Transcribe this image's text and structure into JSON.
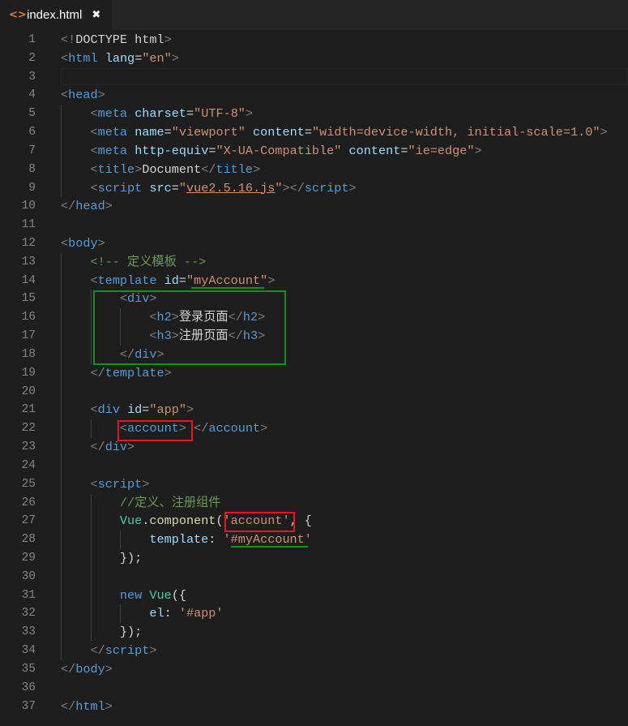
{
  "tab": {
    "icon": "html-file-icon",
    "icon_glyph": "<>",
    "label": "index.html",
    "close_glyph": "✖"
  },
  "lines": [
    {
      "n": "1"
    },
    {
      "n": "2"
    },
    {
      "n": "3"
    },
    {
      "n": "4"
    },
    {
      "n": "5"
    },
    {
      "n": "6"
    },
    {
      "n": "7"
    },
    {
      "n": "8"
    },
    {
      "n": "9"
    },
    {
      "n": "10"
    },
    {
      "n": "11"
    },
    {
      "n": "12"
    },
    {
      "n": "13"
    },
    {
      "n": "14"
    },
    {
      "n": "15"
    },
    {
      "n": "16"
    },
    {
      "n": "17"
    },
    {
      "n": "18"
    },
    {
      "n": "19"
    },
    {
      "n": "20"
    },
    {
      "n": "21"
    },
    {
      "n": "22"
    },
    {
      "n": "23"
    },
    {
      "n": "24"
    },
    {
      "n": "25"
    },
    {
      "n": "26"
    },
    {
      "n": "27"
    },
    {
      "n": "28"
    },
    {
      "n": "29"
    },
    {
      "n": "30"
    },
    {
      "n": "31"
    },
    {
      "n": "32"
    },
    {
      "n": "33"
    },
    {
      "n": "34"
    },
    {
      "n": "35"
    },
    {
      "n": "36"
    },
    {
      "n": "37"
    }
  ],
  "code": [
    [
      [
        "br",
        "<!"
      ],
      [
        "txt",
        "DOCTYPE html"
      ],
      [
        "br",
        ">"
      ]
    ],
    [
      [
        "br",
        "<"
      ],
      [
        "tag",
        "html"
      ],
      [
        "txt",
        " "
      ],
      [
        "attr",
        "lang"
      ],
      [
        "txt",
        "="
      ],
      [
        "str",
        "\"en\""
      ],
      [
        "br",
        ">"
      ]
    ],
    [],
    [
      [
        "br",
        "<"
      ],
      [
        "tag",
        "head"
      ],
      [
        "br",
        ">"
      ]
    ],
    [
      [
        "txt",
        "    "
      ],
      [
        "br",
        "<"
      ],
      [
        "tag",
        "meta"
      ],
      [
        "txt",
        " "
      ],
      [
        "attr",
        "charset"
      ],
      [
        "txt",
        "="
      ],
      [
        "str",
        "\"UTF-8\""
      ],
      [
        "br",
        ">"
      ]
    ],
    [
      [
        "txt",
        "    "
      ],
      [
        "br",
        "<"
      ],
      [
        "tag",
        "meta"
      ],
      [
        "txt",
        " "
      ],
      [
        "attr",
        "name"
      ],
      [
        "txt",
        "="
      ],
      [
        "str",
        "\"viewport\""
      ],
      [
        "txt",
        " "
      ],
      [
        "attr",
        "content"
      ],
      [
        "txt",
        "="
      ],
      [
        "str",
        "\"width=device-width, initial-scale=1.0\""
      ],
      [
        "br",
        ">"
      ]
    ],
    [
      [
        "txt",
        "    "
      ],
      [
        "br",
        "<"
      ],
      [
        "tag",
        "meta"
      ],
      [
        "txt",
        " "
      ],
      [
        "attr",
        "http-equiv"
      ],
      [
        "txt",
        "="
      ],
      [
        "str",
        "\"X-UA-Compatible\""
      ],
      [
        "txt",
        " "
      ],
      [
        "attr",
        "content"
      ],
      [
        "txt",
        "="
      ],
      [
        "str",
        "\"ie=edge\""
      ],
      [
        "br",
        ">"
      ]
    ],
    [
      [
        "txt",
        "    "
      ],
      [
        "br",
        "<"
      ],
      [
        "tag",
        "title"
      ],
      [
        "br",
        ">"
      ],
      [
        "txt",
        "Document"
      ],
      [
        "br",
        "</"
      ],
      [
        "tag",
        "title"
      ],
      [
        "br",
        ">"
      ]
    ],
    [
      [
        "txt",
        "    "
      ],
      [
        "br",
        "<"
      ],
      [
        "tag",
        "script"
      ],
      [
        "txt",
        " "
      ],
      [
        "attr",
        "src"
      ],
      [
        "txt",
        "="
      ],
      [
        "str",
        "\""
      ],
      [
        "link",
        "vue2.5.16.js"
      ],
      [
        "str",
        "\""
      ],
      [
        "br",
        "></"
      ],
      [
        "tag",
        "script"
      ],
      [
        "br",
        ">"
      ]
    ],
    [
      [
        "br",
        "</"
      ],
      [
        "tag",
        "head"
      ],
      [
        "br",
        ">"
      ]
    ],
    [],
    [
      [
        "br",
        "<"
      ],
      [
        "tag",
        "body"
      ],
      [
        "br",
        ">"
      ]
    ],
    [
      [
        "txt",
        "    "
      ],
      [
        "cm",
        "<!-- 定义模板 -->"
      ]
    ],
    [
      [
        "txt",
        "    "
      ],
      [
        "br",
        "<"
      ],
      [
        "tag",
        "template"
      ],
      [
        "txt",
        " "
      ],
      [
        "attr",
        "id"
      ],
      [
        "txt",
        "="
      ],
      [
        "str",
        "\"myAccount\""
      ],
      [
        "br",
        ">"
      ]
    ],
    [
      [
        "txt",
        "        "
      ],
      [
        "br",
        "<"
      ],
      [
        "tag",
        "div"
      ],
      [
        "br",
        ">"
      ]
    ],
    [
      [
        "txt",
        "            "
      ],
      [
        "br",
        "<"
      ],
      [
        "tag",
        "h2"
      ],
      [
        "br",
        ">"
      ],
      [
        "txt",
        "登录页面"
      ],
      [
        "br",
        "</"
      ],
      [
        "tag",
        "h2"
      ],
      [
        "br",
        ">"
      ]
    ],
    [
      [
        "txt",
        "            "
      ],
      [
        "br",
        "<"
      ],
      [
        "tag",
        "h3"
      ],
      [
        "br",
        ">"
      ],
      [
        "txt",
        "注册页面"
      ],
      [
        "br",
        "</"
      ],
      [
        "tag",
        "h3"
      ],
      [
        "br",
        ">"
      ]
    ],
    [
      [
        "txt",
        "        "
      ],
      [
        "br",
        "</"
      ],
      [
        "tag",
        "div"
      ],
      [
        "br",
        ">"
      ]
    ],
    [
      [
        "txt",
        "    "
      ],
      [
        "br",
        "</"
      ],
      [
        "tag",
        "template"
      ],
      [
        "br",
        ">"
      ]
    ],
    [],
    [
      [
        "txt",
        "    "
      ],
      [
        "br",
        "<"
      ],
      [
        "tag",
        "div"
      ],
      [
        "txt",
        " "
      ],
      [
        "attr",
        "id"
      ],
      [
        "txt",
        "="
      ],
      [
        "str",
        "\"app\""
      ],
      [
        "br",
        ">"
      ]
    ],
    [
      [
        "txt",
        "        "
      ],
      [
        "br",
        "<"
      ],
      [
        "tag",
        "account"
      ],
      [
        "br",
        ">"
      ],
      [
        "txt",
        " "
      ],
      [
        "br",
        "</"
      ],
      [
        "tag",
        "account"
      ],
      [
        "br",
        ">"
      ]
    ],
    [
      [
        "txt",
        "    "
      ],
      [
        "br",
        "</"
      ],
      [
        "tag",
        "div"
      ],
      [
        "br",
        ">"
      ]
    ],
    [],
    [
      [
        "txt",
        "    "
      ],
      [
        "br",
        "<"
      ],
      [
        "tag",
        "script"
      ],
      [
        "br",
        ">"
      ]
    ],
    [
      [
        "txt",
        "        "
      ],
      [
        "cm",
        "//定义、注册组件"
      ]
    ],
    [
      [
        "txt",
        "        "
      ],
      [
        "cls",
        "Vue"
      ],
      [
        "txt",
        "."
      ],
      [
        "fn",
        "component"
      ],
      [
        "txt",
        "("
      ],
      [
        "str",
        "'account'"
      ],
      [
        "txt",
        ", {"
      ]
    ],
    [
      [
        "txt",
        "            "
      ],
      [
        "prop",
        "template"
      ],
      [
        "txt",
        ": "
      ],
      [
        "str",
        "'#myAccount'"
      ]
    ],
    [
      [
        "txt",
        "        });"
      ]
    ],
    [],
    [
      [
        "txt",
        "        "
      ],
      [
        "kw",
        "new"
      ],
      [
        "txt",
        " "
      ],
      [
        "cls",
        "Vue"
      ],
      [
        "txt",
        "({"
      ]
    ],
    [
      [
        "txt",
        "            "
      ],
      [
        "prop",
        "el"
      ],
      [
        "txt",
        ": "
      ],
      [
        "str",
        "'#app'"
      ]
    ],
    [
      [
        "txt",
        "        });"
      ]
    ],
    [
      [
        "txt",
        "    "
      ],
      [
        "br",
        "</"
      ],
      [
        "tag",
        "script"
      ],
      [
        "br",
        ">"
      ]
    ],
    [
      [
        "br",
        "</"
      ],
      [
        "tag",
        "body"
      ],
      [
        "br",
        ">"
      ]
    ],
    [],
    [
      [
        "br",
        "</"
      ],
      [
        "tag",
        "html"
      ],
      [
        "br",
        ">"
      ]
    ]
  ],
  "annotations": {
    "green_box_lines": "15-18",
    "red_boxes": [
      "<account>",
      "'account'"
    ],
    "green_underlines": [
      "\"myAccount\"",
      "'#myAccount'"
    ]
  },
  "colors": {
    "background": "#1e1e1e",
    "tab_icon": "#e37933",
    "annotation_green": "#1e8c1e",
    "annotation_red": "#e8171f"
  }
}
